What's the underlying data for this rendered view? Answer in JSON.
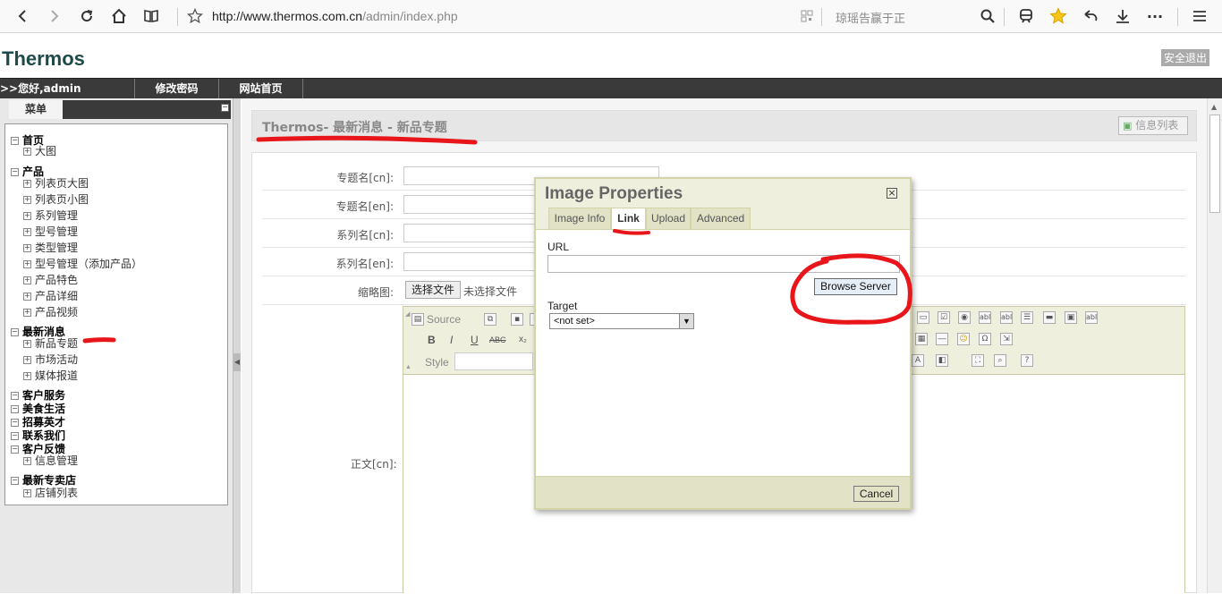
{
  "browser": {
    "url_host": "http://www.thermos.com.cn",
    "url_path": "/admin/index.php",
    "search_text": "琼瑶告赢于正"
  },
  "site": {
    "title": "Thermos",
    "logout": "安全退出"
  },
  "nav": {
    "greeting": ">>您好,admin",
    "change_password": "修改密码",
    "homepage": "网站首页"
  },
  "sidebar": {
    "menu_tab": "菜单",
    "tree": [
      {
        "label": "首页",
        "type": "cat"
      },
      {
        "label": "大图",
        "type": "sub"
      },
      {
        "label": "产品",
        "type": "cat"
      },
      {
        "label": "列表页大图",
        "type": "sub"
      },
      {
        "label": "列表页小图",
        "type": "sub"
      },
      {
        "label": "系列管理",
        "type": "sub"
      },
      {
        "label": "型号管理",
        "type": "sub"
      },
      {
        "label": "类型管理",
        "type": "sub"
      },
      {
        "label": "型号管理（添加产品）",
        "type": "sub"
      },
      {
        "label": "产品特色",
        "type": "sub"
      },
      {
        "label": "产品详细",
        "type": "sub"
      },
      {
        "label": "产品视频",
        "type": "sub"
      },
      {
        "label": "最新消息",
        "type": "cat"
      },
      {
        "label": "新品专题",
        "type": "sub"
      },
      {
        "label": "市场活动",
        "type": "sub"
      },
      {
        "label": "媒体报道",
        "type": "sub"
      },
      {
        "label": "客户服务",
        "type": "cat"
      },
      {
        "label": "美食生活",
        "type": "cat"
      },
      {
        "label": "招募英才",
        "type": "cat"
      },
      {
        "label": "联系我们",
        "type": "cat"
      },
      {
        "label": "客户反馈",
        "type": "cat"
      },
      {
        "label": "信息管理",
        "type": "sub"
      },
      {
        "label": "最新专卖店",
        "type": "cat"
      },
      {
        "label": "店铺列表",
        "type": "sub"
      }
    ]
  },
  "content": {
    "breadcrumb": "Thermos- 最新消息 - 新品专题",
    "info_list_button": "信息列表",
    "fields": [
      {
        "label": "专题名[cn]:"
      },
      {
        "label": "专题名[en]:"
      },
      {
        "label": "系列名[cn]:"
      },
      {
        "label": "系列名[en]:"
      }
    ],
    "thumb_label": "缩略图:",
    "choose_file": "选择文件",
    "no_file": "未选择文件",
    "body_label": "正文[cn]:"
  },
  "editor": {
    "source": "Source",
    "style": "Style",
    "bold": "B",
    "italic": "I",
    "underline": "U",
    "strike": "ABC"
  },
  "dialog": {
    "title": "Image Properties",
    "tabs": [
      "Image Info",
      "Link",
      "Upload",
      "Advanced"
    ],
    "active_tab": "Link",
    "url_label": "URL",
    "url_value": "",
    "browse_server": "Browse Server",
    "target_label": "Target",
    "target_value": "<not set>",
    "cancel": "Cancel"
  }
}
